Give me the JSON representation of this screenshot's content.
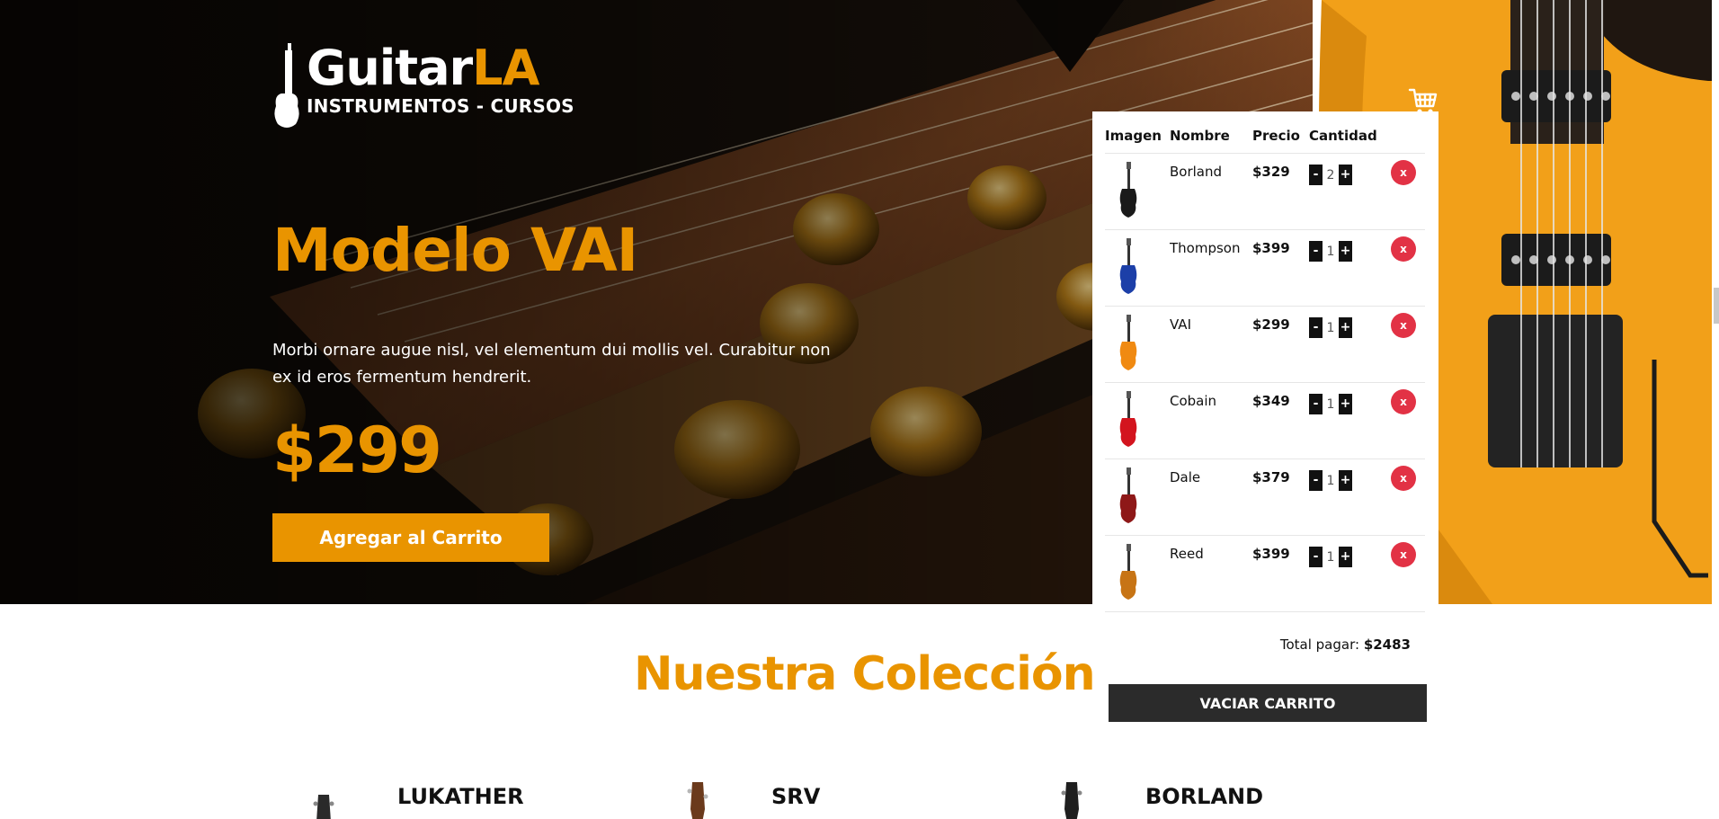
{
  "header": {
    "logo": {
      "brand_main": "Guitar",
      "brand_accent": "LA",
      "tagline": "INSTRUMENTOS - CURSOS"
    },
    "cart_icon": "shopping-cart-icon"
  },
  "hero": {
    "title": "Modelo VAI",
    "description": "Morbi ornare augue nisl, vel elementum dui mollis vel. Curabitur non ex id eros fermentum hendrerit.",
    "price": "$299",
    "add_button_label": "Agregar al Carrito"
  },
  "cart": {
    "columns": [
      "Imagen",
      "Nombre",
      "Precio",
      "Cantidad"
    ],
    "items": [
      {
        "name": "Borland",
        "price": "$329",
        "qty": "2",
        "color": "#1a1a1a"
      },
      {
        "name": "Thompson",
        "price": "$399",
        "qty": "1",
        "color": "#1c3fa8"
      },
      {
        "name": "VAI",
        "price": "$299",
        "qty": "1",
        "color": "#f08a12"
      },
      {
        "name": "Cobain",
        "price": "$349",
        "qty": "1",
        "color": "#d3141e"
      },
      {
        "name": "Dale",
        "price": "$379",
        "qty": "1",
        "color": "#8e1818"
      },
      {
        "name": "Reed",
        "price": "$399",
        "qty": "1",
        "color": "#c77415"
      }
    ],
    "minus_label": "-",
    "plus_label": "+",
    "delete_label": "x",
    "total_label": "Total pagar:",
    "total_value": "$2483",
    "clear_button_label": "VACIAR CARRITO"
  },
  "collection": {
    "title": "Nuestra Colección",
    "products": [
      {
        "name": "LUKATHER"
      },
      {
        "name": "SRV"
      },
      {
        "name": "BORLAND"
      }
    ]
  },
  "colors": {
    "accent": "#e99400",
    "danger": "#e23245",
    "dark": "#2b2b2b"
  }
}
